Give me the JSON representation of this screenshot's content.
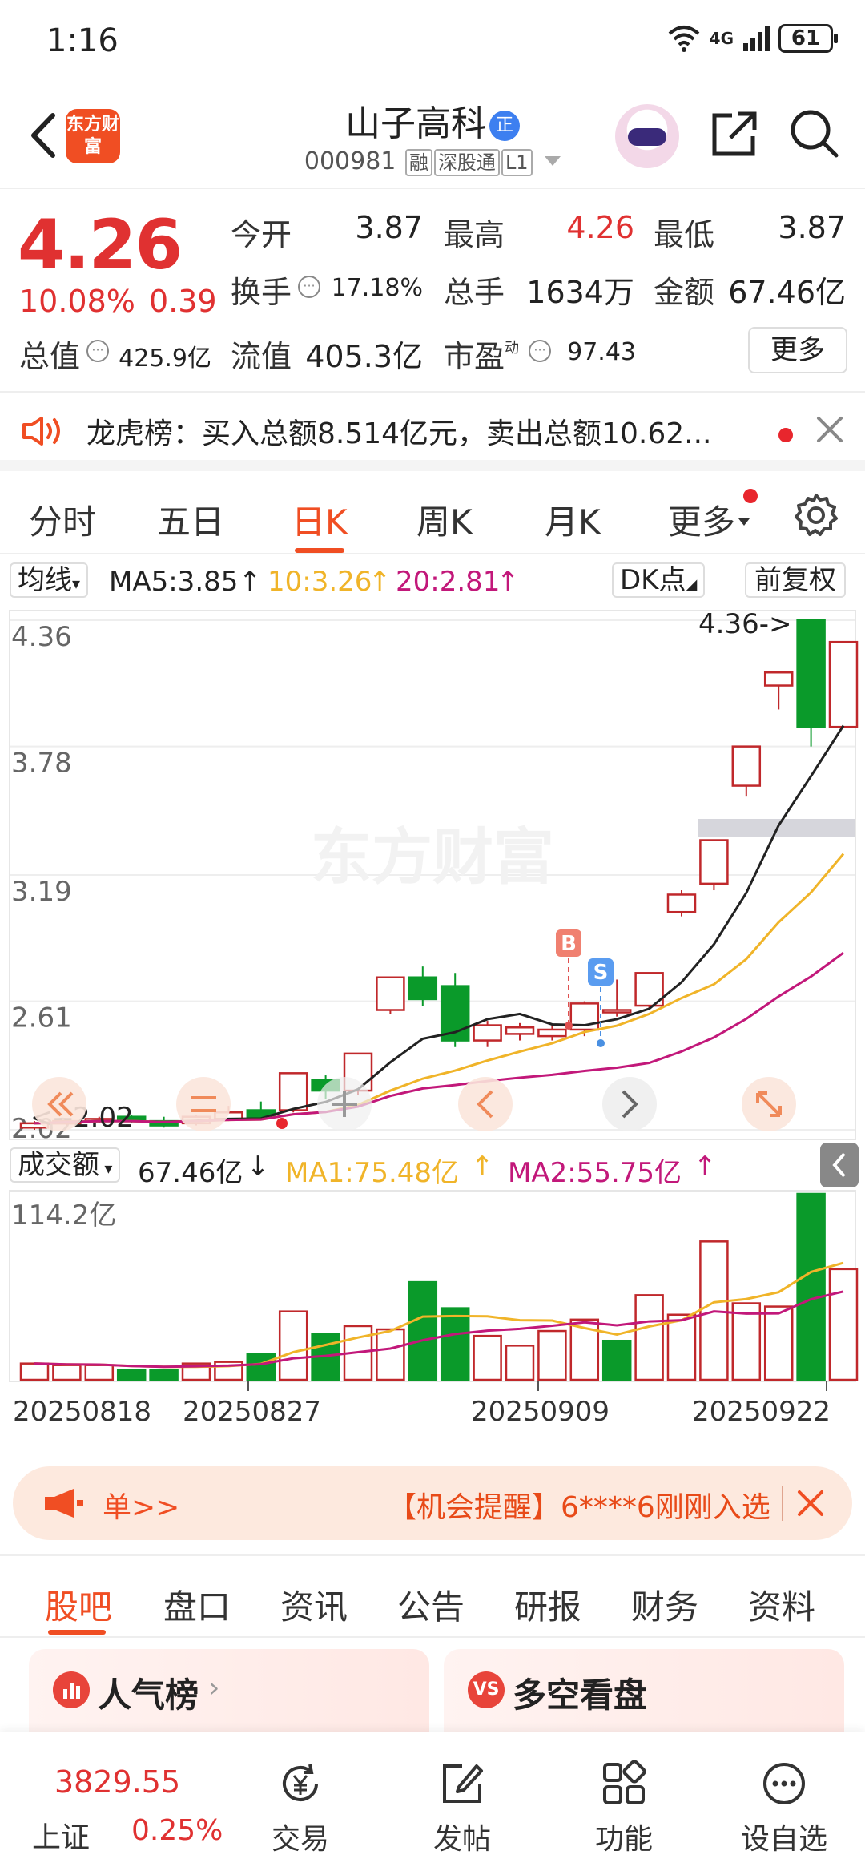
{
  "status": {
    "time": "1:16",
    "network": "4G",
    "battery": "61"
  },
  "header": {
    "app_logo": "东方财富",
    "stock_name": "山子高科",
    "name_badge": "正",
    "stock_code": "000981",
    "tags": [
      "融",
      "深股通",
      "L1"
    ]
  },
  "quote": {
    "price": "4.26",
    "change_pct": "10.08%",
    "change": "0.39",
    "open_label": "今开",
    "open": "3.87",
    "high_label": "最高",
    "high": "4.26",
    "low_label": "最低",
    "low": "3.87",
    "turnover_label": "换手",
    "turnover": "17.18%",
    "volume_label": "总手",
    "volume": "1634万",
    "amount_label": "金额",
    "amount": "67.46亿",
    "mcap_label": "总值",
    "mcap": "425.9亿",
    "float_label": "流值",
    "float": "405.3亿",
    "pe_label": "市盈",
    "pe_sup": "动",
    "pe": "97.43",
    "more_label": "更多"
  },
  "notice": {
    "text": "龙虎榜：买入总额8.514亿元，卖出总额10.62..."
  },
  "tabs": {
    "items": [
      "分时",
      "五日",
      "日K",
      "周K",
      "月K",
      "更多"
    ],
    "active": "日K"
  },
  "ma_row": {
    "selector": "均线",
    "ma5": "MA5:3.85",
    "ma10": "10:3.26",
    "ma20": "20:2.81",
    "dk": "DK点",
    "adjust": "前复权",
    "colors": {
      "ma5": "#222222",
      "ma10": "#f0b429",
      "ma20": "#c2187a"
    }
  },
  "chart": {
    "watermark": "东方财富",
    "y_ticks": [
      "4.36",
      "3.78",
      "3.19",
      "2.61",
      "2.02"
    ],
    "max_marker": "4.36->",
    "min_marker": "<--2.02",
    "signal_buy": "B",
    "signal_sell": "S",
    "up_color": "#c0282b",
    "down_color": "#0a9a2a"
  },
  "volume_row": {
    "selector": "成交额",
    "value": "67.46亿",
    "ma1": "MA1:75.48亿",
    "ma2": "MA2:55.75亿",
    "y_max": "114.2亿"
  },
  "dates": [
    "20250818",
    "20250827",
    "20250909",
    "20250922"
  ],
  "chart_data": {
    "type": "candlestick",
    "title": "",
    "ylim": [
      2.02,
      4.36
    ],
    "candles": [
      {
        "o": 2.03,
        "c": 2.05,
        "h": 2.06,
        "l": 2.02,
        "up": true
      },
      {
        "o": 2.05,
        "c": 2.06,
        "h": 2.07,
        "l": 2.04,
        "up": true
      },
      {
        "o": 2.06,
        "c": 2.07,
        "h": 2.08,
        "l": 2.05,
        "up": true
      },
      {
        "o": 2.08,
        "c": 2.06,
        "h": 2.09,
        "l": 2.05,
        "up": false
      },
      {
        "o": 2.06,
        "c": 2.04,
        "h": 2.08,
        "l": 2.03,
        "up": false
      },
      {
        "o": 2.05,
        "c": 2.08,
        "h": 2.09,
        "l": 2.04,
        "up": true
      },
      {
        "o": 2.07,
        "c": 2.1,
        "h": 2.13,
        "l": 2.06,
        "up": true
      },
      {
        "o": 2.11,
        "c": 2.08,
        "h": 2.15,
        "l": 2.07,
        "up": false
      },
      {
        "o": 2.11,
        "c": 2.28,
        "h": 2.28,
        "l": 2.1,
        "up": true
      },
      {
        "o": 2.25,
        "c": 2.2,
        "h": 2.27,
        "l": 2.16,
        "up": false
      },
      {
        "o": 2.2,
        "c": 2.37,
        "h": 2.37,
        "l": 2.18,
        "up": true
      },
      {
        "o": 2.57,
        "c": 2.72,
        "h": 2.72,
        "l": 2.55,
        "up": true
      },
      {
        "o": 2.72,
        "c": 2.62,
        "h": 2.77,
        "l": 2.59,
        "up": false
      },
      {
        "o": 2.68,
        "c": 2.43,
        "h": 2.74,
        "l": 2.4,
        "up": false
      },
      {
        "o": 2.43,
        "c": 2.5,
        "h": 2.52,
        "l": 2.4,
        "up": true
      },
      {
        "o": 2.46,
        "c": 2.49,
        "h": 2.51,
        "l": 2.43,
        "up": true
      },
      {
        "o": 2.45,
        "c": 2.48,
        "h": 2.5,
        "l": 2.43,
        "up": true
      },
      {
        "o": 2.48,
        "c": 2.6,
        "h": 2.61,
        "l": 2.45,
        "up": true
      },
      {
        "o": 2.56,
        "c": 2.57,
        "h": 2.71,
        "l": 2.54,
        "up": true
      },
      {
        "o": 2.59,
        "c": 2.74,
        "h": 2.74,
        "l": 2.57,
        "up": true
      },
      {
        "o": 3.02,
        "c": 3.1,
        "h": 3.12,
        "l": 3.0,
        "up": true
      },
      {
        "o": 3.15,
        "c": 3.35,
        "h": 3.35,
        "l": 3.12,
        "up": true
      },
      {
        "o": 3.6,
        "c": 3.78,
        "h": 3.78,
        "l": 3.55,
        "up": true
      },
      {
        "o": 4.06,
        "c": 4.12,
        "h": 4.12,
        "l": 3.95,
        "up": true
      },
      {
        "o": 4.36,
        "c": 3.87,
        "h": 4.36,
        "l": 3.78,
        "up": false
      },
      {
        "o": 3.87,
        "c": 4.26,
        "h": 4.26,
        "l": 3.87,
        "up": true
      }
    ],
    "volume_ylim": [
      0,
      114.2
    ],
    "volume": [
      10,
      9,
      9,
      6,
      6,
      10,
      11,
      16,
      42,
      28,
      33,
      31,
      60,
      44,
      27,
      21,
      30,
      37,
      24,
      52,
      40,
      85,
      47,
      45,
      114.2,
      68
    ],
    "volume_up": [
      true,
      true,
      true,
      false,
      false,
      true,
      true,
      false,
      true,
      false,
      true,
      true,
      false,
      false,
      true,
      true,
      true,
      true,
      false,
      true,
      true,
      true,
      true,
      true,
      false,
      true
    ]
  },
  "banner": {
    "left": "单>>",
    "right": "【机会提醒】6****6刚刚入选"
  },
  "bottom_tabs": {
    "items": [
      "股吧",
      "盘口",
      "资讯",
      "公告",
      "研报",
      "财务",
      "资料"
    ],
    "active": "股吧"
  },
  "cards": [
    {
      "title": "人气榜",
      "icon": "hot-rank-icon"
    },
    {
      "title": "多空看盘",
      "icon": "vs-icon",
      "icon_text": "VS"
    }
  ],
  "nav": {
    "index_value": "3829.55",
    "index_name": "上证",
    "index_pct": "0.25%",
    "items": [
      "交易",
      "发帖",
      "功能",
      "设自选"
    ]
  }
}
